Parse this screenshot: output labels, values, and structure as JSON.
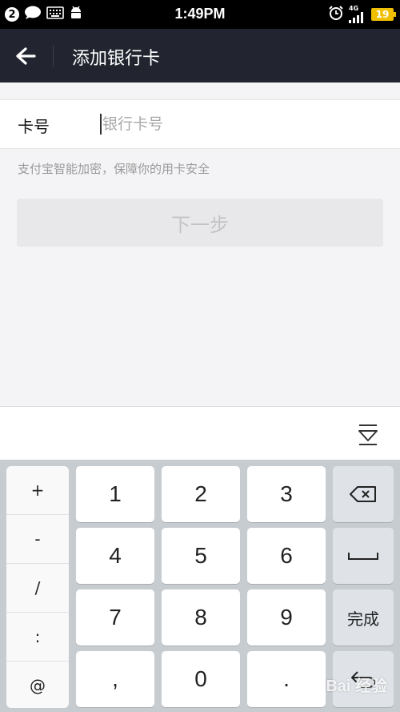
{
  "status_bar": {
    "notification_count": "2",
    "time": "1:49PM",
    "network": "4G",
    "battery": "19"
  },
  "header": {
    "title": "添加银行卡"
  },
  "form": {
    "card_label": "卡号",
    "card_placeholder": "银行卡号",
    "hint": "支付宝智能加密，保障你的用卡安全",
    "next_label": "下一步"
  },
  "keyboard": {
    "symbols": [
      "+",
      "-",
      "/",
      ":",
      "@"
    ],
    "keys": [
      [
        "1",
        "2",
        "3"
      ],
      [
        "4",
        "5",
        "6"
      ],
      [
        "7",
        "8",
        "9"
      ],
      [
        ",",
        "0",
        "."
      ]
    ],
    "done_label": "完成"
  },
  "watermark": "Bai 经验"
}
